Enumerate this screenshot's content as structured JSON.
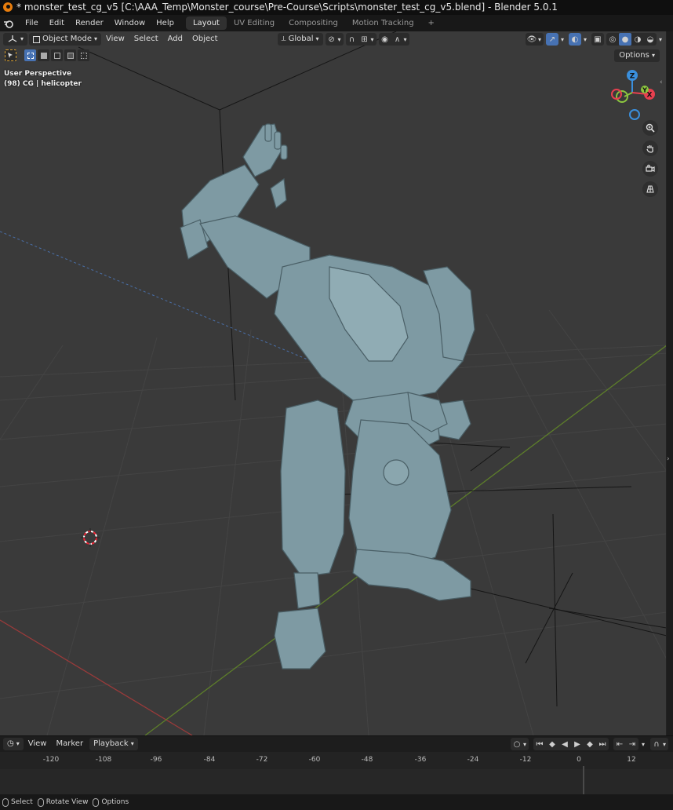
{
  "window": {
    "title": "* monster_test_cg_v5 [C:\\AAA_Temp\\Monster_course\\Pre-Course\\Scripts\\monster_test_cg_v5.blend] - Blender 5.0.1"
  },
  "menu": {
    "items": [
      "File",
      "Edit",
      "Render",
      "Window",
      "Help"
    ],
    "workspace_tabs": [
      "Layout",
      "UV Editing",
      "Compositing",
      "Motion Tracking"
    ],
    "active_tab": "Layout",
    "add_tab": "+"
  },
  "viewport": {
    "mode": "Object Mode",
    "menus": [
      "View",
      "Select",
      "Add",
      "Object"
    ],
    "transform_orientation": "Global",
    "options_label": "Options",
    "info_line1": "User Perspective",
    "info_line2": "(98) CG | helicopter",
    "gizmo_axes": {
      "x": "X",
      "y": "Y",
      "z": "Z"
    },
    "axis_colors": {
      "x": "#e8404f",
      "y": "#8cc63f",
      "z": "#3a8fdc"
    },
    "nav_icons": [
      "zoom-icon",
      "pan-hand-icon",
      "camera-icon",
      "grid-icon"
    ]
  },
  "timeline": {
    "menus": [
      "View",
      "Marker"
    ],
    "playback_label": "Playback",
    "ticks": [
      "-120",
      "-108",
      "-96",
      "-84",
      "-72",
      "-60",
      "-48",
      "-36",
      "-24",
      "-12",
      "0",
      "12"
    ]
  },
  "statusbar": {
    "items": [
      "Select",
      "Rotate View",
      "Options"
    ]
  }
}
